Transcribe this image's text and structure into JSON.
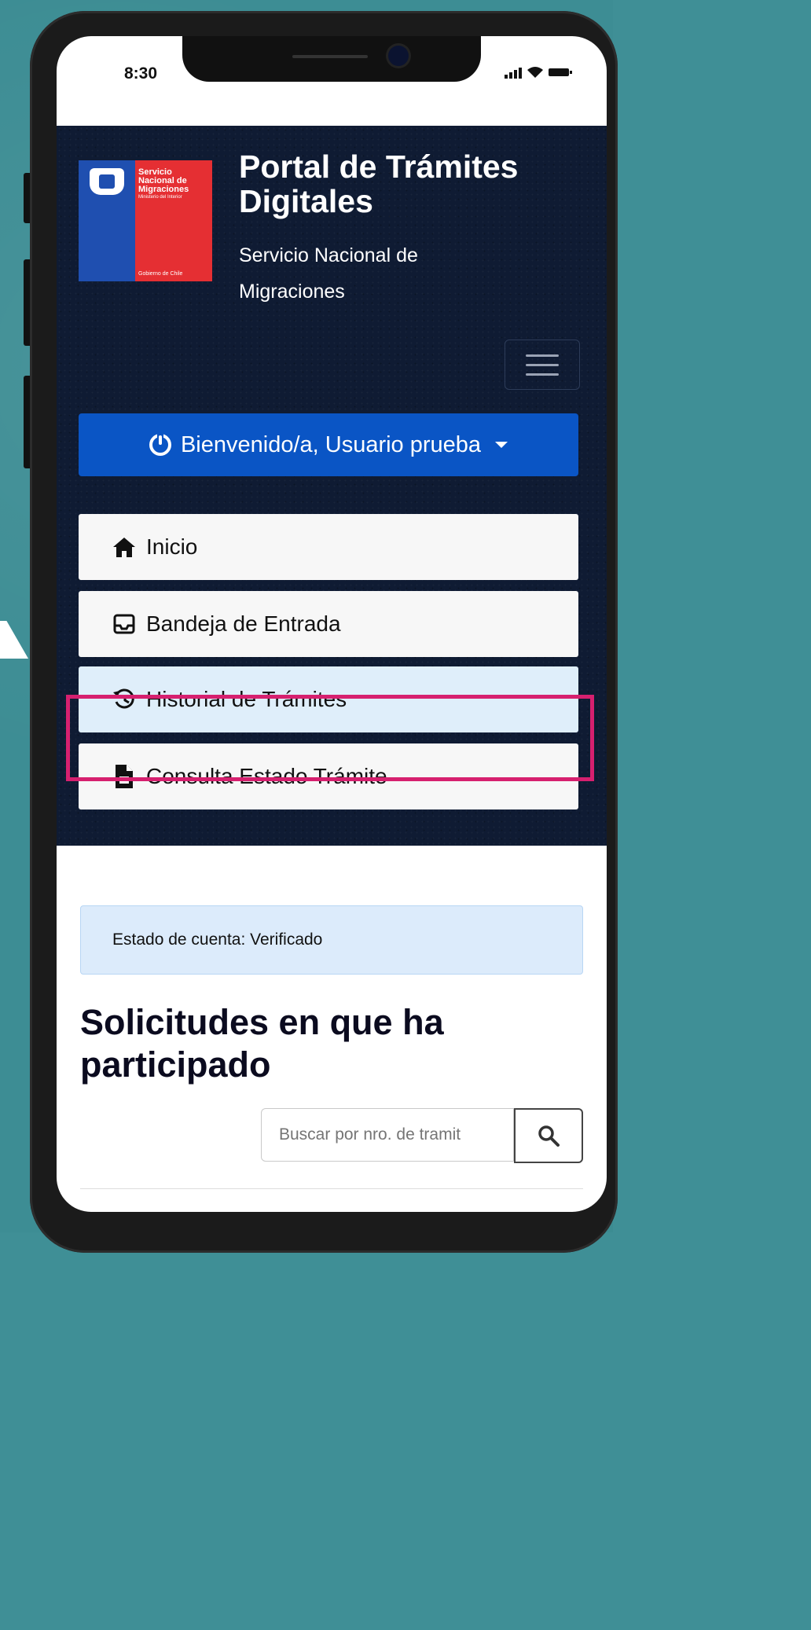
{
  "status_bar": {
    "time": "8:30"
  },
  "header": {
    "logo": {
      "line1": "Servicio",
      "line2": "Nacional de",
      "line3": "Migraciones",
      "line4": "Ministerio del Interior",
      "footer": "Gobierno de Chile"
    },
    "title": "Portal de Trámites Digitales",
    "subtitle": "Servicio Nacional de Migraciones",
    "menu_icon": "hamburger-menu-icon"
  },
  "user_menu": {
    "label": "Bienvenido/a, Usuario prueba"
  },
  "nav": {
    "items": [
      {
        "label": "Inicio",
        "icon": "home-icon"
      },
      {
        "label": "Bandeja de Entrada",
        "icon": "inbox-icon"
      },
      {
        "label": "Historial de Trámites",
        "icon": "history-icon",
        "active": true
      },
      {
        "label": "Consulta Estado Trámite",
        "icon": "document-icon"
      }
    ]
  },
  "account": {
    "status_text": "Estado de cuenta: Verificado"
  },
  "requests": {
    "title": "Solicitudes en que ha participado",
    "search_placeholder": "Buscar por nro. de tramit"
  },
  "colors": {
    "header_bg": "#0f1b33",
    "welcome_button": "#0a55c5",
    "highlight_border": "#d6206f",
    "active_nav_bg": "#dfeefa"
  }
}
